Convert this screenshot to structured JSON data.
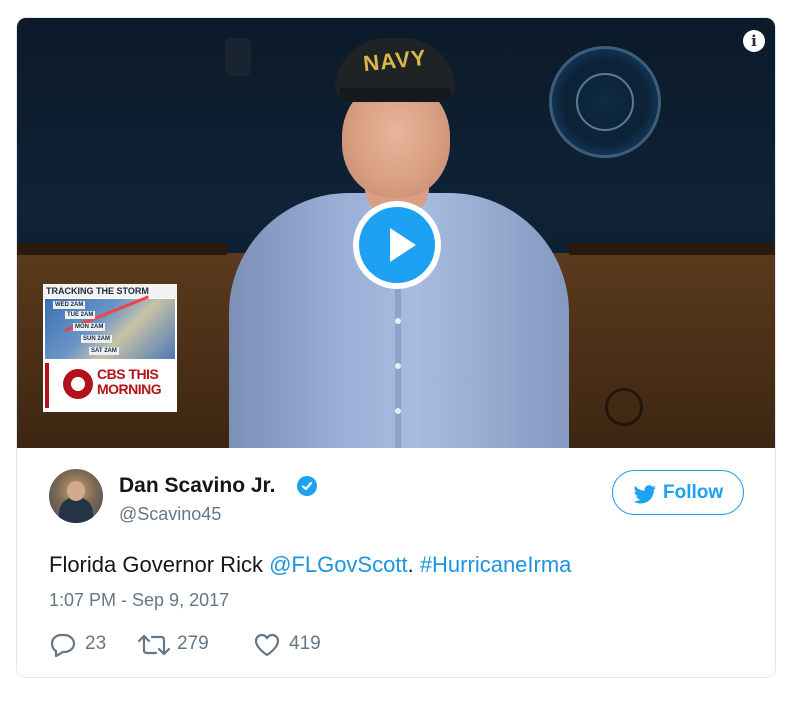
{
  "video": {
    "overlay_title": "TRACKING THE STORM",
    "storm_days": [
      "WED 2AM",
      "TUE 2AM",
      "MON 2AM",
      "SUN 2AM",
      "SAT 2AM"
    ],
    "cbs_line1": "CBS THIS",
    "cbs_line2": "MORNING",
    "cap_text": "NAVY",
    "info_glyph": "i",
    "play_icon": "play-icon"
  },
  "author": {
    "name": "Dan Scavino Jr.",
    "handle": "@Scavino45",
    "verified": true
  },
  "follow_button": {
    "label": "Follow"
  },
  "tweet": {
    "text_prefix": "Florida Governor Rick ",
    "mention": "@FLGovScott",
    "separator": ". ",
    "hashtag": "#HurricaneIrma",
    "timestamp": "1:07 PM - Sep 9, 2017"
  },
  "actions": {
    "replies": "23",
    "retweets": "279",
    "likes": "419"
  },
  "colors": {
    "accent": "#1da1f2",
    "link": "#1b95e0",
    "muted": "#657786",
    "text": "#14171a"
  }
}
